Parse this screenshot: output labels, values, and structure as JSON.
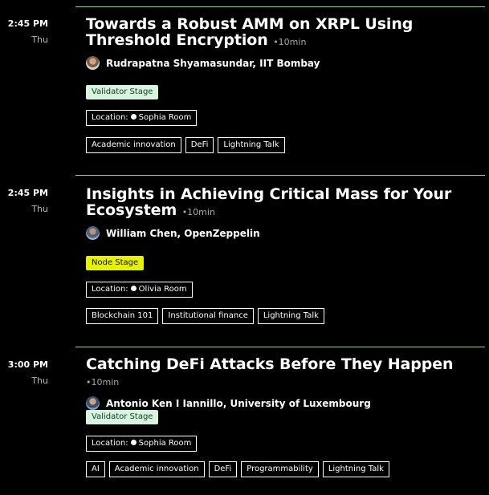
{
  "sessions": [
    {
      "time": "2:45 PM",
      "day": "Thu",
      "title": "Towards a Robust AMM on XRPL Using Threshold Encryption",
      "duration": "•10min",
      "speaker": "Rudrapatna Shyamasundar, IIT Bombay",
      "stage": "Validator Stage",
      "location_label": "Location:",
      "location": "Sophia Room",
      "tags": [
        "Academic innovation",
        "DeFi",
        "Lightning Talk"
      ]
    },
    {
      "time": "2:45 PM",
      "day": "Thu",
      "title": "Insights in Achieving Critical Mass for Your Ecosystem",
      "duration": "•10min",
      "speaker": "William Chen, OpenZeppelin",
      "stage": "Node Stage",
      "location_label": "Location:",
      "location": "Olivia Room",
      "tags": [
        "Blockchain 101",
        "Institutional finance",
        "Lightning Talk"
      ]
    },
    {
      "time": "3:00 PM",
      "day": "Thu",
      "title": "Catching DeFi Attacks Before They Happen",
      "duration": "•10min",
      "speaker": "Antonio Ken I Iannillo, University of Luxembourg",
      "stage": "Validator Stage",
      "location_label": "Location:",
      "location": "Sophia Room",
      "tags": [
        "AI",
        "Academic innovation",
        "DeFi",
        "Programmability",
        "Lightning Talk"
      ]
    }
  ],
  "colors": {
    "divider": "#8fd8a3",
    "validator_stage_bg": "#d8f3e0",
    "node_stage_bg": "#e6f000"
  },
  "icons": {
    "location": "filled-circle-dot",
    "speaker": "avatar-photo"
  }
}
